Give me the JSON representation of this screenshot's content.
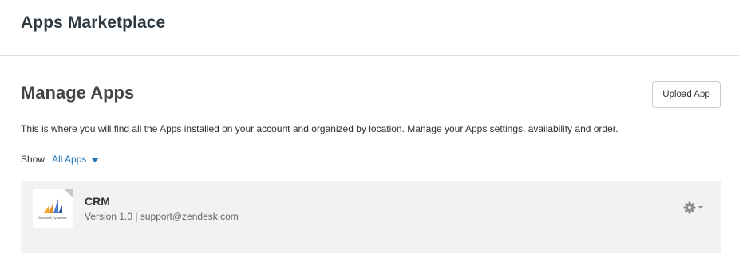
{
  "header": {
    "title": "Apps Marketplace"
  },
  "main": {
    "title": "Manage Apps",
    "upload_button_label": "Upload App",
    "description": "This is where you will find all the Apps installed on your account and organized by location. Manage your Apps settings, availability and order.",
    "show_label": "Show",
    "show_filter_value": "All Apps",
    "apps": [
      {
        "name": "CRM",
        "version": "Version 1.0",
        "separator": " | ",
        "support": "support@zendesk.com",
        "logo_text": "Microsoft Dynamics",
        "logo_colors": [
          "#f5a623",
          "#4a7bd0",
          "#2b4f9e"
        ],
        "settings_icon": "gear-icon"
      }
    ]
  },
  "colors": {
    "accent": "#1f73b7",
    "panel_bg": "#f2f2f2",
    "border": "#dcdcdc"
  }
}
